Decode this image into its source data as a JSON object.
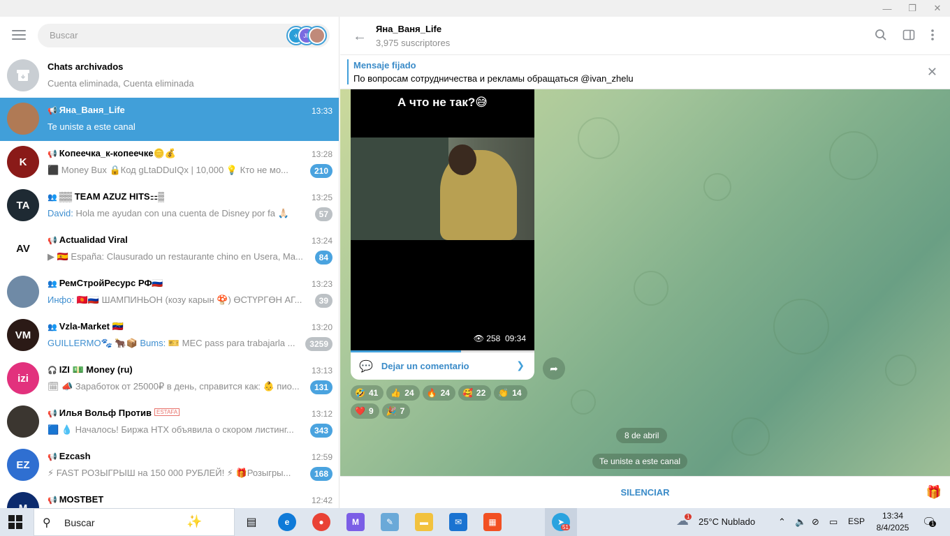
{
  "window": {
    "minimize_icon": "—",
    "restore_icon": "❐",
    "close_icon": "✕"
  },
  "left": {
    "search_placeholder": "Buscar",
    "archive": {
      "title": "Chats archivados",
      "preview": "Cuenta eliminada, Cuenta eliminada"
    },
    "chats": [
      {
        "icon": "📢",
        "name": "Яна_Ваня_Life",
        "time": "13:33",
        "preview_hl": "",
        "preview": "Te uniste a este canal",
        "badge": "",
        "avatar_color": "#b07a55",
        "avatar_text": "",
        "active": true
      },
      {
        "icon": "📢",
        "name": "Копеечка_к-копеечке🪙💰",
        "time": "13:28",
        "preview_hl": "",
        "preview": "⬛ Money Bux 🔒Код gLtaDDuIQx | 10,000 💡 Кто не мо...",
        "badge": "210",
        "avatar_color": "#8a1a18",
        "avatar_text": "K"
      },
      {
        "icon": "👥",
        "name": "▒▒ TEAM AZUZ HITS⚏▒",
        "time": "13:25",
        "preview_hl": "David: ",
        "preview": "Hola me ayudan con una cuenta de Disney por fa 🙏🏻",
        "badge": "57",
        "badge_muted": true,
        "avatar_color": "#1e2a33",
        "avatar_text": "TA"
      },
      {
        "icon": "📢",
        "name": "Actualidad Viral",
        "time": "13:24",
        "preview_hl": "",
        "preview": "▶ 🇪🇸 España: Clausurado un restaurante chino en Usera, Ma...",
        "badge": "84",
        "avatar_color": "#ffffff",
        "avatar_text": "AV"
      },
      {
        "icon": "👥",
        "name": "РемСтройРесурс РФ🇷🇺",
        "time": "13:23",
        "preview_hl": "Инфо: ",
        "preview": "🇰🇬🇷🇺 ШАМПИНЬОН (козу карын 🍄) ӨСТҮРГӨН АГ...",
        "badge": "39",
        "badge_muted": true,
        "avatar_color": "#6f8aa6",
        "avatar_text": ""
      },
      {
        "icon": "👥",
        "name": "Vzla-Market 🇻🇪",
        "time": "13:20",
        "preview_hl": "GUILLERMO🐾 🐂📦 Bums: ",
        "preview": "🎫 MEC pass para trabajarla ...",
        "badge": "3259",
        "badge_muted": true,
        "avatar_color": "#2b1a16",
        "avatar_text": "VM"
      },
      {
        "icon": "🎧",
        "name": "IZI 💵 Money (ru)",
        "time": "13:13",
        "preview_hl": "",
        "preview": "🗓 📣 Заработок от 25000₽ в день, справится как: 👶 пио...",
        "badge": "131",
        "avatar_color": "#e2317d",
        "avatar_text": "izi"
      },
      {
        "icon": "📢",
        "name": "Илья Вольф Против",
        "tag": "ESTAFA",
        "time": "13:12",
        "preview_hl": "",
        "preview": "🟦 💧 Началось! Биржа HTX объявила о скором листинг...",
        "badge": "343",
        "avatar_color": "#3b3630",
        "avatar_text": ""
      },
      {
        "icon": "📢",
        "name": "Ezcash",
        "time": "12:59",
        "preview_hl": "",
        "preview": "⚡ FAST РОЗЫГРЫШ на 150 000 РУБЛЕЙ! ⚡ 🎁Розыгры...",
        "badge": "168",
        "avatar_color": "#2f6fd1",
        "avatar_text": "EZ"
      },
      {
        "icon": "📢",
        "name": "MOSTBET",
        "time": "12:42",
        "preview_hl": "",
        "preview": "",
        "badge": "",
        "avatar_color": "#0c2b6e",
        "avatar_text": "M"
      }
    ]
  },
  "right": {
    "title": "Яна_Ваня_Life",
    "subtitle": "3,975 suscriptores",
    "pinned": {
      "title": "Mensaje fijado",
      "text": "По вопросам сотрудничества и рекламы обращаться @ivan_zhelu"
    },
    "post": {
      "caption": "А что не так?😅",
      "views": "258",
      "time": "09:34",
      "progress": 0.6,
      "comment_label": "Dejar un comentario"
    },
    "reactions": [
      {
        "emoji": "🤣",
        "count": "41"
      },
      {
        "emoji": "👍",
        "count": "24"
      },
      {
        "emoji": "🔥",
        "count": "24"
      },
      {
        "emoji": "🥰",
        "count": "22"
      },
      {
        "emoji": "👏",
        "count": "14"
      },
      {
        "emoji": "❤️",
        "count": "9"
      },
      {
        "emoji": "🎉",
        "count": "7"
      }
    ],
    "date_label": "8 de abril",
    "service_message": "Te uniste a este canal",
    "mute_label": "SILENCIAR"
  },
  "taskbar": {
    "search_placeholder": "Buscar",
    "weather": "25°C  Nublado",
    "weather_badge": "1",
    "language": "ESP",
    "time": "13:34",
    "date": "8/4/2025",
    "notification_count": "1",
    "telegram_badge": "51"
  }
}
